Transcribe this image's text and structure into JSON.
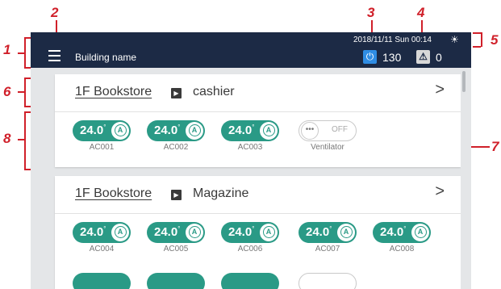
{
  "callouts": [
    "1",
    "2",
    "3",
    "4",
    "5",
    "6",
    "7",
    "8"
  ],
  "header": {
    "menu_icon": "hamburger-menu-icon",
    "building_name": "Building name",
    "datetime": "2018/11/11 Sun 00:14",
    "weather_icon": "sun-icon",
    "power_icon": "power-icon",
    "power_count": "130",
    "warning_icon": "warning-triangle-icon",
    "warning_count": "0"
  },
  "groups": [
    {
      "floor": "1F Bookstore",
      "zone": "cashier",
      "units": [
        {
          "name": "AC001",
          "temp": "24.0",
          "unit_symbol": "°",
          "mode": "A",
          "state": "on"
        },
        {
          "name": "AC002",
          "temp": "24.0",
          "unit_symbol": "°",
          "mode": "A",
          "state": "on"
        },
        {
          "name": "AC003",
          "temp": "24.0",
          "unit_symbol": "°",
          "mode": "A",
          "state": "on"
        },
        {
          "name": "Ventilator",
          "dots": "•••",
          "off_label": "OFF",
          "state": "off"
        }
      ]
    },
    {
      "floor": "1F Bookstore",
      "zone": "Magazine",
      "units": [
        {
          "name": "AC004",
          "temp": "24.0",
          "unit_symbol": "°",
          "mode": "A",
          "state": "on"
        },
        {
          "name": "AC005",
          "temp": "24.0",
          "unit_symbol": "°",
          "mode": "A",
          "state": "on"
        },
        {
          "name": "AC006",
          "temp": "24.0",
          "unit_symbol": "°",
          "mode": "A",
          "state": "on"
        },
        {
          "name": "AC007",
          "temp": "24.0",
          "unit_symbol": "°",
          "mode": "A",
          "state": "on"
        },
        {
          "name": "AC008",
          "temp": "24.0",
          "unit_symbol": "°",
          "mode": "A",
          "state": "on"
        }
      ]
    }
  ],
  "colors": {
    "topbar": "#1c2a45",
    "accent_teal": "#2a9a86",
    "callout_red": "#d0202a",
    "power_blue": "#2f8de4"
  }
}
